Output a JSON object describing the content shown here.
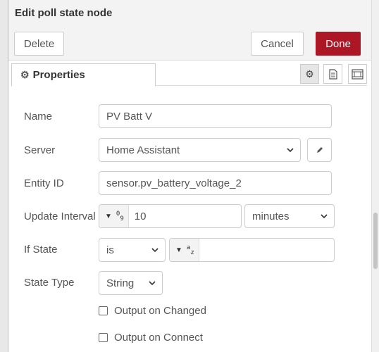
{
  "header": {
    "title": "Edit poll state node",
    "delete_label": "Delete",
    "cancel_label": "Cancel",
    "done_label": "Done"
  },
  "tabs": {
    "properties_label": "Properties",
    "icons": [
      "gear-icon",
      "description-icon",
      "appearance-icon"
    ]
  },
  "form": {
    "name": {
      "label": "Name",
      "value": "PV Batt V"
    },
    "server": {
      "label": "Server",
      "value": "Home Assistant"
    },
    "entity_id": {
      "label": "Entity ID",
      "value": "sensor.pv_battery_voltage_2"
    },
    "update_interval": {
      "label": "Update Interval",
      "value": "10",
      "units": "minutes"
    },
    "if_state": {
      "label": "If State",
      "operator": "is",
      "value": ""
    },
    "state_type": {
      "label": "State Type",
      "value": "String"
    },
    "output_on_changed": {
      "label": "Output on Changed",
      "checked": false
    },
    "output_on_connect": {
      "label": "Output on Connect",
      "checked": false
    }
  },
  "colors": {
    "done_bg": "#ad1625",
    "header_bg": "#f3f3f3"
  }
}
